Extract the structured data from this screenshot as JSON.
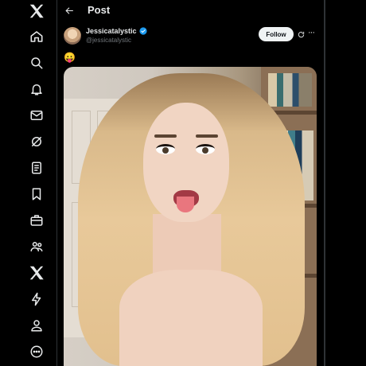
{
  "sidebar": {
    "items": [
      {
        "name": "x-logo-icon"
      },
      {
        "name": "home-icon"
      },
      {
        "name": "search-icon"
      },
      {
        "name": "notifications-icon"
      },
      {
        "name": "messages-icon"
      },
      {
        "name": "grok-icon"
      },
      {
        "name": "lists-icon"
      },
      {
        "name": "bookmarks-icon"
      },
      {
        "name": "jobs-icon"
      },
      {
        "name": "communities-icon"
      },
      {
        "name": "premium-icon"
      },
      {
        "name": "verified-orgs-icon"
      },
      {
        "name": "profile-icon"
      },
      {
        "name": "more-icon"
      }
    ]
  },
  "header": {
    "title": "Post"
  },
  "post": {
    "display_name": "Jessicatalystic",
    "handle": "@jessicatalystic",
    "follow_label": "Follow",
    "more_label": "···",
    "text": "😛"
  },
  "colors": {
    "background": "#000000",
    "text": "#e7e9ea",
    "muted": "#71767b",
    "verified": "#1d9bf0",
    "border": "#2f3336"
  }
}
